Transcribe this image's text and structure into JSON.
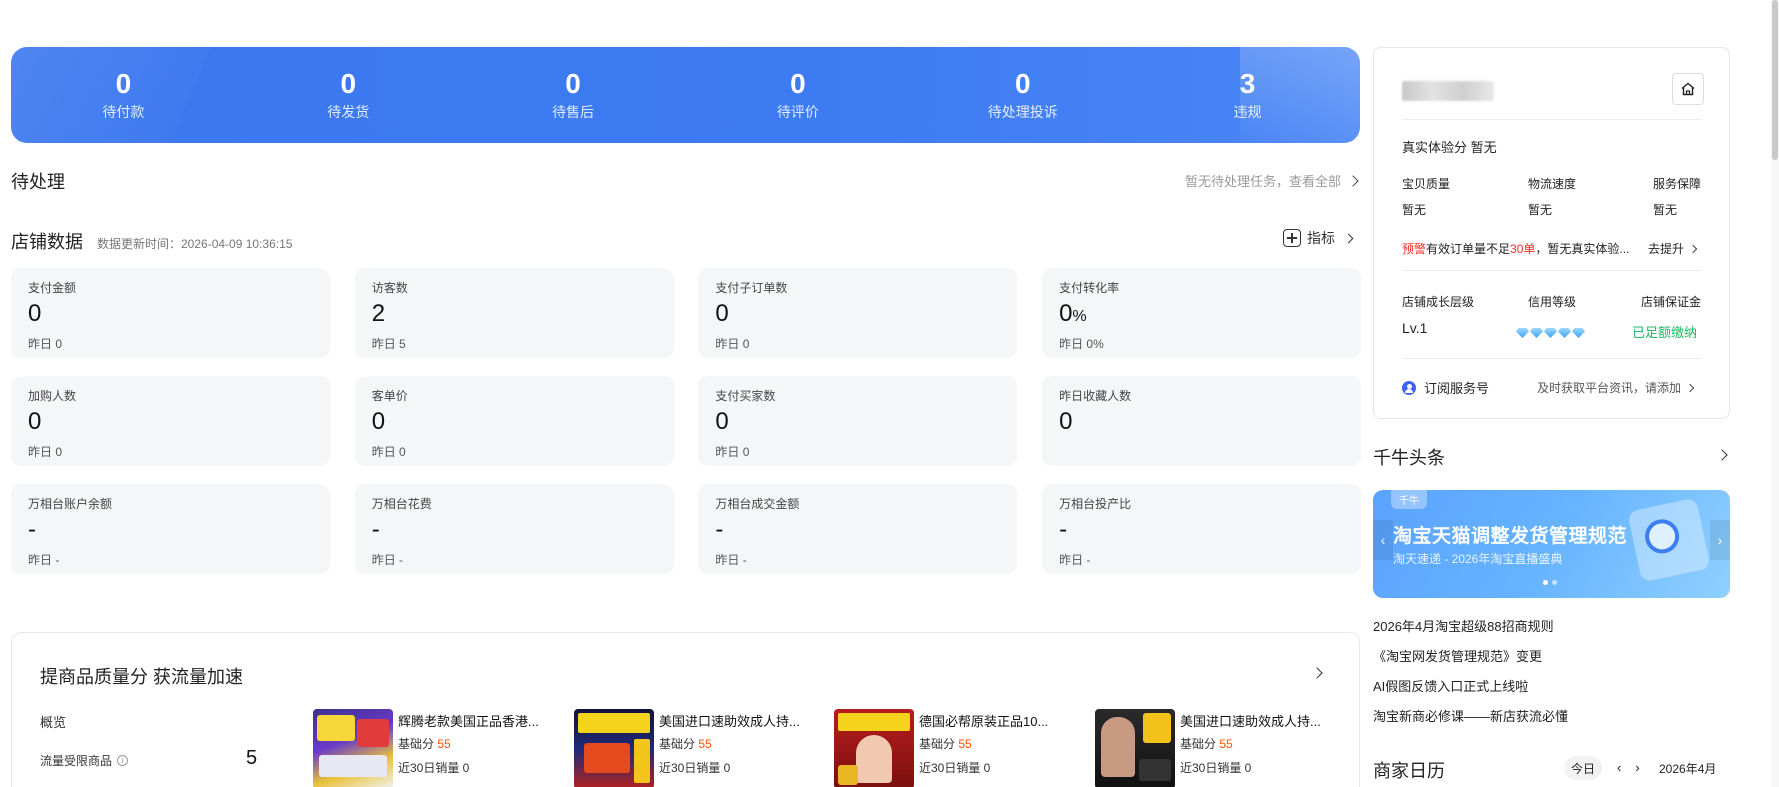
{
  "status_bar": [
    {
      "num": "0",
      "label": "待付款"
    },
    {
      "num": "0",
      "label": "待发货"
    },
    {
      "num": "0",
      "label": "待售后"
    },
    {
      "num": "0",
      "label": "待评价"
    },
    {
      "num": "0",
      "label": "待处理投诉"
    },
    {
      "num": "3",
      "label": "违规"
    }
  ],
  "todo": {
    "title": "待处理",
    "link": "暂无待处理任务，查看全部"
  },
  "shop_data": {
    "title": "店铺数据",
    "updated": "数据更新时间：2026-04-09 10:36:15",
    "metric_link": "指标",
    "cards": [
      {
        "title": "支付金额",
        "value": "0",
        "unit": "",
        "yesterday": "昨日 0"
      },
      {
        "title": "访客数",
        "value": "2",
        "unit": "",
        "yesterday": "昨日 5"
      },
      {
        "title": "支付子订单数",
        "value": "0",
        "unit": "",
        "yesterday": "昨日 0"
      },
      {
        "title": "支付转化率",
        "value": "0",
        "unit": "%",
        "yesterday": "昨日 0%"
      },
      {
        "title": "加购人数",
        "value": "0",
        "unit": "",
        "yesterday": "昨日 0"
      },
      {
        "title": "客单价",
        "value": "0",
        "unit": "",
        "yesterday": "昨日 0"
      },
      {
        "title": "支付买家数",
        "value": "0",
        "unit": "",
        "yesterday": "昨日 0"
      },
      {
        "title": "昨日收藏人数",
        "value": "0",
        "unit": "",
        "yesterday": ""
      },
      {
        "title": "万相台账户余额",
        "value": "-",
        "unit": "",
        "yesterday": "昨日 -"
      },
      {
        "title": "万相台花费",
        "value": "-",
        "unit": "",
        "yesterday": "昨日 -"
      },
      {
        "title": "万相台成交金额",
        "value": "-",
        "unit": "",
        "yesterday": "昨日 -"
      },
      {
        "title": "万相台投产比",
        "value": "-",
        "unit": "",
        "yesterday": "昨日 -"
      }
    ]
  },
  "quality": {
    "title": "提商品质量分 获流量加速",
    "overview": "概览",
    "limited_label": "流量受限商品",
    "limited_value": "5",
    "products": [
      {
        "name": "辉腾老款美国正品香港...",
        "score_label": "基础分",
        "score": "55",
        "sales": "近30日销量 0"
      },
      {
        "name": "美国进口速助效成人持...",
        "score_label": "基础分",
        "score": "55",
        "sales": "近30日销量 0"
      },
      {
        "name": "德国必帮原装正品10...",
        "score_label": "基础分",
        "score": "55",
        "sales": "近30日销量 0"
      },
      {
        "name": "美国进口速助效成人持...",
        "score_label": "基础分",
        "score": "55",
        "sales": "近30日销量 0"
      }
    ]
  },
  "shop_card": {
    "experience": "真实体验分 暂无",
    "metrics": [
      {
        "label": "宝贝质量",
        "value": "暂无"
      },
      {
        "label": "物流速度",
        "value": "暂无"
      },
      {
        "label": "服务保障",
        "value": "暂无"
      }
    ],
    "warning_prefix": "预警",
    "warning_mid": "有效订单量不足",
    "warning_num": "30单",
    "warning_suffix": "，暂无真实体验...",
    "warning_link": "去提升",
    "growth_label": "店铺成长层级",
    "growth_value": "Lv.1",
    "credit_label": "信用等级",
    "deposit_label": "店铺保证金",
    "deposit_value": "已足额缴纳",
    "subscribe": "订阅服务号",
    "subscribe_hint": "及时获取平台资讯，请添加"
  },
  "headlines": {
    "title": "千牛头条",
    "banner_tag": "千牛",
    "banner_title": "淘宝天猫调整发货管理规范",
    "banner_sub": "淘天速递 - 2026年淘宝直播盛典",
    "items": [
      "2026年4月淘宝超级88招商规则",
      "《淘宝网发货管理规范》变更",
      "AI假图反馈入口正式上线啦",
      "淘宝新商必修课——新店获流必懂"
    ]
  },
  "calendar": {
    "title": "商家日历",
    "today": "今日",
    "month": "2026年4月"
  },
  "colors": {
    "banner_blue": "#3d7bf3",
    "score_orange": "#ff5000",
    "warn_red": "#ff2a2a",
    "ok_green": "#1fba62"
  }
}
